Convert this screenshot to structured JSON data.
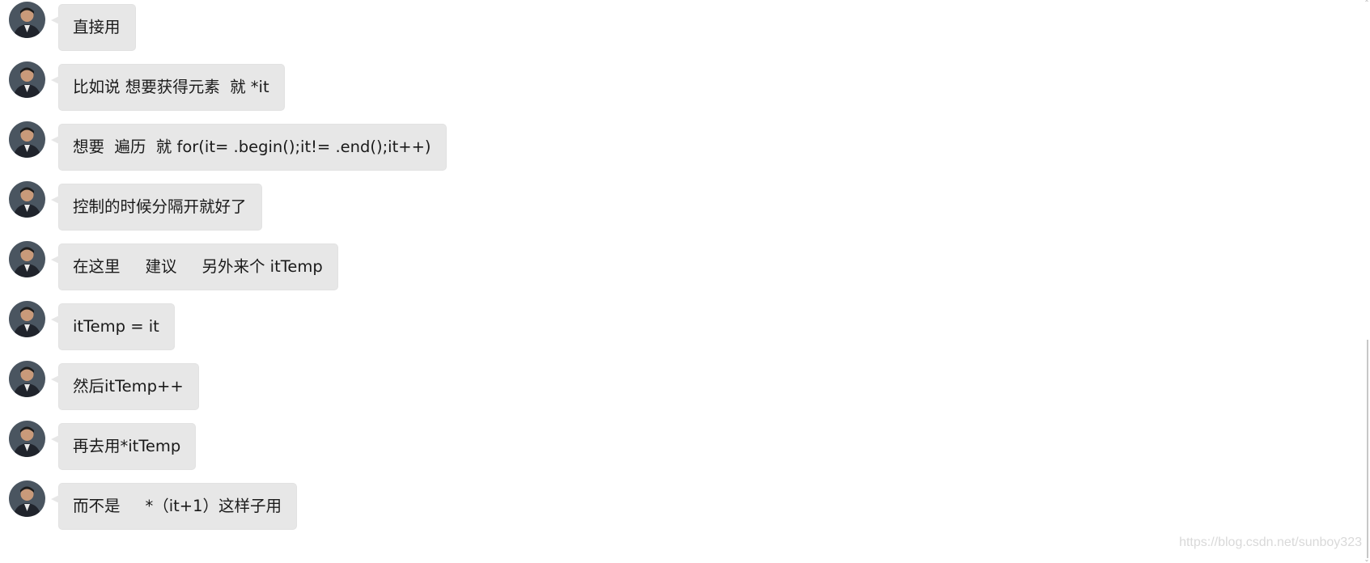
{
  "messages": [
    {
      "text": "直接用"
    },
    {
      "text": "比如说 想要获得元素  就 *it"
    },
    {
      "text": "想要  遍历  就 for(it= .begin();it!= .end();it++)"
    },
    {
      "text": "控制的时候分隔开就好了"
    },
    {
      "text": "在这里     建议     另外来个 itTemp"
    },
    {
      "text": "itTemp = it"
    },
    {
      "text": "然后itTemp++"
    },
    {
      "text": "再去用*itTemp"
    },
    {
      "text": "而不是     *（it+1）这样子用"
    }
  ],
  "watermark": "https://blog.csdn.net/sunboy323",
  "colors": {
    "bubble": "#e7e7e7",
    "text": "#1a1a1a",
    "background": "#ffffff"
  },
  "icons": {
    "avatar": "user-avatar-photo",
    "scroll_up": "chevron-up-icon",
    "scroll_down": "chevron-down-icon"
  }
}
